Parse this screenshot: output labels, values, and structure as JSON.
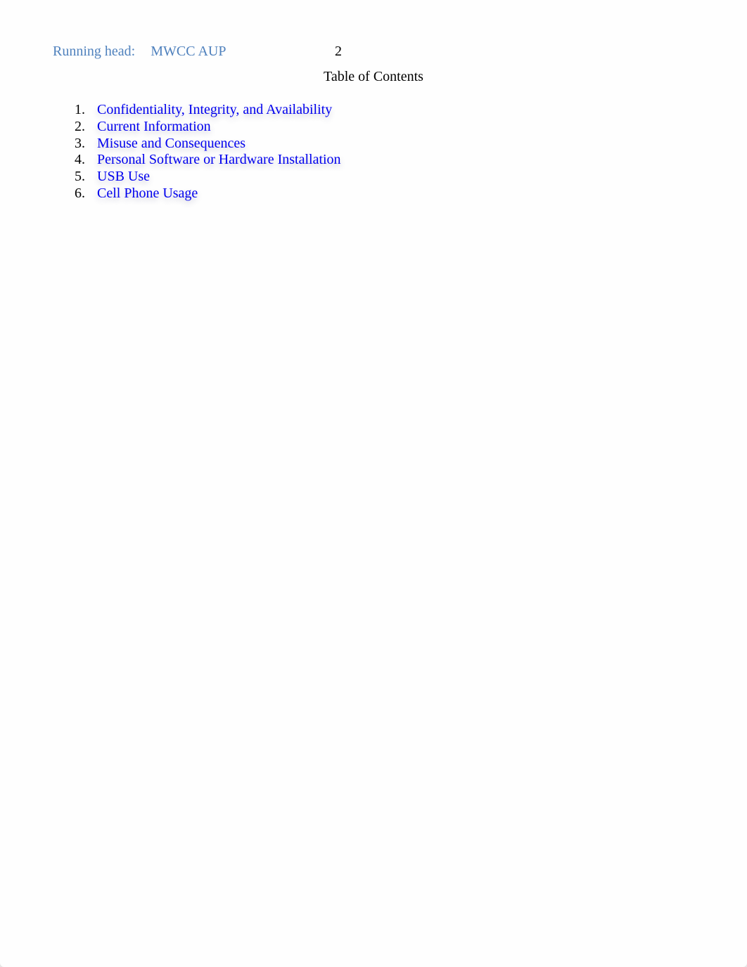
{
  "header": {
    "running_head_label": "Running head:",
    "running_head_title": "MWCC AUP",
    "page_number": "2"
  },
  "toc": {
    "title": "Table of Contents",
    "items": [
      {
        "number": "1.",
        "label": "Confidentiality, Integrity, and Availability"
      },
      {
        "number": "2.",
        "label": "Current Information"
      },
      {
        "number": "3.",
        "label": "Misuse and Consequences"
      },
      {
        "number": "4.",
        "label": "Personal Software or Hardware Installation"
      },
      {
        "number": "5.",
        "label": "USB Use"
      },
      {
        "number": "6.",
        "label": "Cell Phone Usage"
      }
    ]
  },
  "colors": {
    "running_head": "#4f81bd",
    "link": "#0000ee",
    "text": "#000000"
  }
}
